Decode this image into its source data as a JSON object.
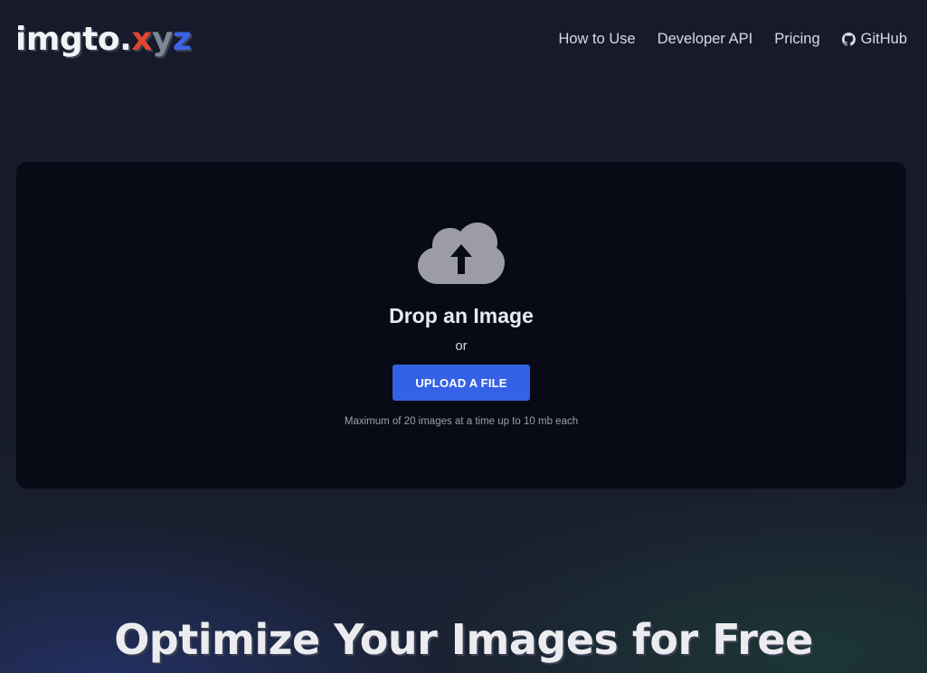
{
  "logo": {
    "main": "imgto.",
    "x": "x",
    "y": "y",
    "z": "z"
  },
  "nav": {
    "how_to_use": "How to Use",
    "developer_api": "Developer API",
    "pricing": "Pricing",
    "github": "GitHub"
  },
  "dropzone": {
    "icon": "cloud-upload-icon",
    "title": "Drop an Image",
    "or": "or",
    "button_label": "UPLOAD A FILE",
    "limit_text": "Maximum of 20 images at a time up to 10 mb each"
  },
  "hero": {
    "title": "Optimize Your Images for Free"
  },
  "colors": {
    "background": "#161a2b",
    "dropzone_bg": "#080a15",
    "accent_button": "#3561e6",
    "logo_x": "#e1462f",
    "logo_y": "#7c8694",
    "logo_z": "#3b64e6"
  }
}
